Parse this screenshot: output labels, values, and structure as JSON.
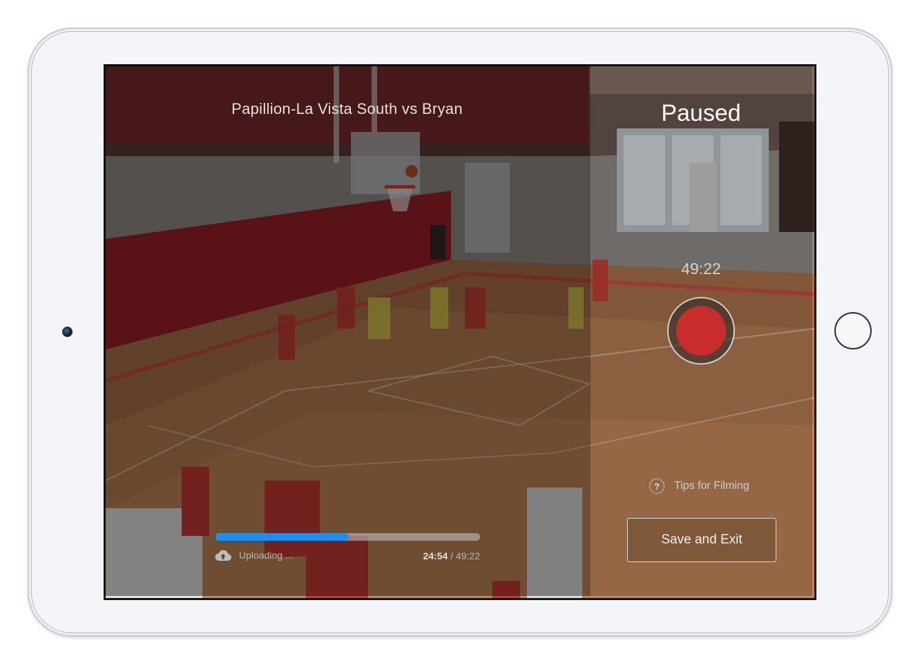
{
  "video": {
    "game_title": "Papillion-La Vista South vs Bryan"
  },
  "recorder": {
    "status": "Paused",
    "elapsed_time": "49:22",
    "tips_label": "Tips for Filming",
    "help_glyph": "?",
    "save_exit_label": "Save and Exit"
  },
  "upload": {
    "status_label": "Uploading ...",
    "current_time": "24:54",
    "separator": " / ",
    "total_time": "49:22",
    "progress_percent": 50.4
  },
  "icons": {
    "help": "help-icon",
    "cloud": "cloud-upload-icon",
    "record": "record-icon"
  },
  "colors": {
    "record_red": "#c92c2c",
    "progress_blue": "#1e8ef0"
  }
}
